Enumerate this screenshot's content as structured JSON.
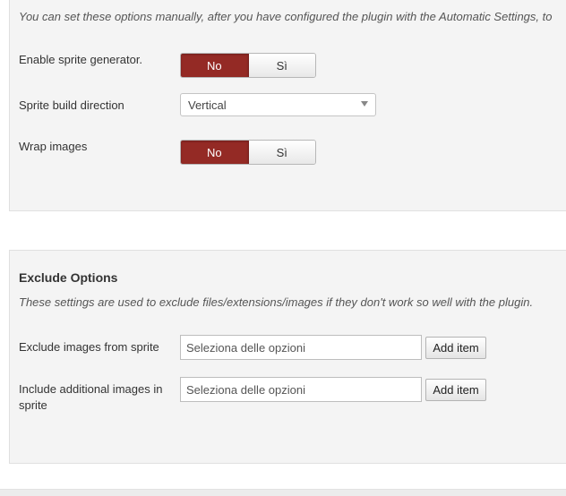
{
  "settings": {
    "intro": "You can set these options manually, after you have configured the plugin with the Automatic Settings, to",
    "rows": [
      {
        "label": "Enable sprite generator.",
        "no": "No",
        "si": "Sì"
      },
      {
        "label": "Sprite build direction",
        "value": "Vertical"
      },
      {
        "label": "Wrap images",
        "no": "No",
        "si": "Sì"
      }
    ]
  },
  "exclude": {
    "title": "Exclude Options",
    "description": "These settings are used to exclude files/extensions/images if they don't work so well with the plugin.",
    "rows": [
      {
        "label": "Exclude images from sprite",
        "placeholder": "Seleziona delle opzioni",
        "button": "Add item"
      },
      {
        "label": "Include additional images in sprite",
        "placeholder": "Seleziona delle opzioni",
        "button": "Add item"
      }
    ]
  },
  "colors": {
    "toggle_active": "#942a25",
    "panel_bg": "#f4f4f4"
  },
  "icons": {
    "select_caret": "chevron-down-icon"
  }
}
